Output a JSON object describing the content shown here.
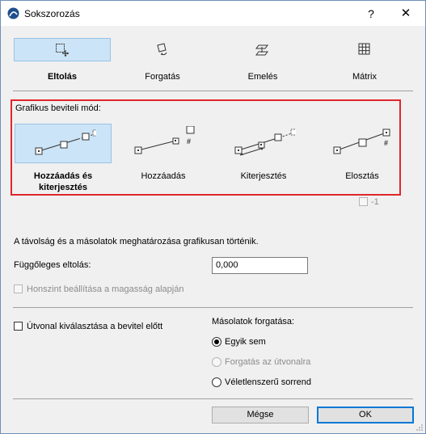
{
  "window": {
    "title": "Sokszorozás",
    "help_label": "?",
    "close_label": "✕"
  },
  "modes": [
    {
      "label": "Eltolás",
      "icon": "move-icon",
      "selected": true
    },
    {
      "label": "Forgatás",
      "icon": "rotate-icon",
      "selected": false
    },
    {
      "label": "Emelés",
      "icon": "elevate-icon",
      "selected": false
    },
    {
      "label": "Mátrix",
      "icon": "matrix-icon",
      "selected": false
    }
  ],
  "graphic_input": {
    "label": "Grafikus beviteli mód:",
    "options": [
      {
        "label": "Hozzáadás és kiterjesztés",
        "icon": "add-extend-icon",
        "selected": true
      },
      {
        "label": "Hozzáadás",
        "icon": "add-icon",
        "selected": false
      },
      {
        "label": "Kiterjesztés",
        "icon": "extend-icon",
        "selected": false
      },
      {
        "label": "Elosztás",
        "icon": "distribute-icon",
        "selected": false
      }
    ],
    "minus_one_label": "-1",
    "minus_one_checked": false
  },
  "info_text": "A távolság és a másolatok meghatározása grafikusan történik.",
  "vertical_offset": {
    "label": "Függőleges eltolás:",
    "value": "0,000"
  },
  "story_from_elevation": {
    "label": "Honszint beállítása a magasság alapján",
    "checked": false,
    "enabled": false
  },
  "path_select": {
    "label": "Útvonal kiválasztása a bevitel előtt",
    "checked": false
  },
  "rotate_copies": {
    "label": "Másolatok forgatása:",
    "options": [
      {
        "label": "Egyik sem",
        "selected": true,
        "enabled": true
      },
      {
        "label": "Forgatás az útvonalra",
        "selected": false,
        "enabled": false
      },
      {
        "label": "Véletlenszerű sorrend",
        "selected": false,
        "enabled": true
      }
    ]
  },
  "buttons": {
    "cancel": "Mégse",
    "ok": "OK"
  },
  "colors": {
    "selection": "#cce4f7",
    "highlight_border": "#e0262b",
    "default_button": "#0078d7"
  }
}
